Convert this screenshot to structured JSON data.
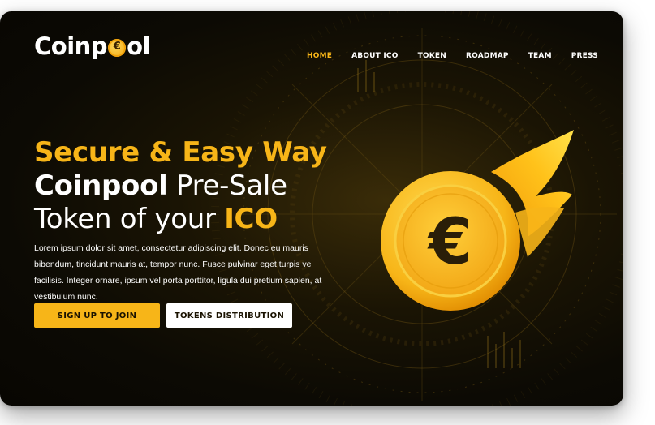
{
  "brand": {
    "logo_prefix": "Coinp",
    "logo_suffix": "ol"
  },
  "nav": {
    "items": [
      {
        "label": "HOME",
        "active": true
      },
      {
        "label": "ABOUT ICO",
        "active": false
      },
      {
        "label": "TOKEN",
        "active": false
      },
      {
        "label": "ROADMAP",
        "active": false
      },
      {
        "label": "TEAM",
        "active": false
      },
      {
        "label": "PRESS",
        "active": false
      }
    ]
  },
  "hero": {
    "line1": "Secure & Easy Way",
    "line2_bold": "Coinpool",
    "line2_rest": " Pre-Sale",
    "line3_rest": "Token of your ",
    "line3_highlight": "ICO",
    "description": "Lorem ipsum dolor sit amet, consectetur adipiscing elit. Donec eu mauris bibendum, tincidunt mauris at, tempor nunc. Fusce pulvinar eget turpis vel facilisis. Integer ornare, ipsum vel porta porttitor, ligula dui pretium sapien, at vestibulum nunc."
  },
  "buttons": {
    "primary_label": "SIGN UP TO JOIN",
    "secondary_label": "TOKENS DISTRIBUTION"
  },
  "coin": {
    "symbol": "€"
  },
  "colors": {
    "accent": "#f7b518",
    "background": "#0c0a04",
    "text": "#ffffff"
  }
}
